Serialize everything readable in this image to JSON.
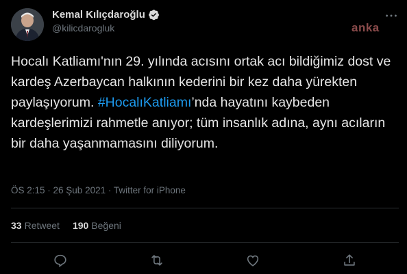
{
  "colors": {
    "background": "#000000",
    "text": "#d9d9d9",
    "secondary": "#6e767d",
    "link": "#1d9bf0",
    "divider": "#2f3336",
    "verified": "#d9d9d9"
  },
  "author": {
    "name": "Kemal Kılıçdaroğlu",
    "handle": "@kilicdarogluk",
    "verified": true
  },
  "watermark": "anka",
  "tweet": {
    "text_before": "Hocalı Katliamı'nın 29. yılında acısını ortak acı bildiğimiz dost ve kardeş Azerbaycan halkının kederini bir kez daha yürekten paylaşıyorum. ",
    "hashtag": "#HocalıKatliamı",
    "text_after": "’nda hayatını kaybeden kardeşlerimizi rahmetle anıyor; tüm insanlık adına, aynı acıların bir daha yaşanmamasını diliyorum."
  },
  "meta": {
    "time": "ÖS 2:15",
    "sep1": " · ",
    "date": "26 Şub 2021",
    "sep2": " · ",
    "source": "Twitter for iPhone"
  },
  "stats": {
    "retweets_count": "33",
    "retweets_label": "Retweet",
    "likes_count": "190",
    "likes_label": "Beğeni"
  },
  "icons": {
    "more": "more-icon",
    "reply": "reply-icon",
    "retweet": "retweet-icon",
    "like": "like-icon",
    "share": "share-icon",
    "verified": "verified-badge-icon"
  }
}
